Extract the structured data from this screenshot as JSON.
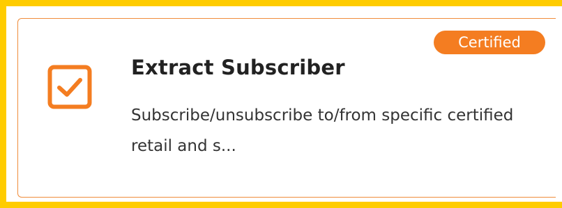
{
  "card": {
    "title": "Extract Subscriber",
    "description": "Subscribe/unsubscribe to/from specific certified retail and s...",
    "badge": "Certified",
    "icon": "checkbox-checked-icon"
  },
  "colors": {
    "frame": "#FFCC00",
    "card_border": "#F08C3A",
    "accent": "#F47D21",
    "title": "#222222",
    "body_text": "#333333"
  }
}
